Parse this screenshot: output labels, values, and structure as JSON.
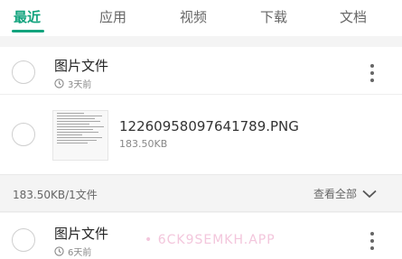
{
  "tabs": [
    {
      "label": "最近",
      "active": true
    },
    {
      "label": "应用",
      "active": false
    },
    {
      "label": "视频",
      "active": false
    },
    {
      "label": "下载",
      "active": false
    },
    {
      "label": "文档",
      "active": false
    }
  ],
  "groups": [
    {
      "title": "图片文件",
      "time": "3天前",
      "files": [
        {
          "name": "12260958097641789.PNG",
          "size": "183.50KB"
        }
      ],
      "summary": "183.50KB/1文件",
      "view_all": "查看全部"
    },
    {
      "title": "图片文件",
      "time": "6天前"
    }
  ],
  "watermark": "• 6CK9SEMKH.APP",
  "colors": {
    "accent": "#12a37d",
    "background": "#f4f4f4",
    "watermark": "#f3c6dc"
  },
  "icons": [
    "clock-icon",
    "more-vertical-icon",
    "chevron-down-icon",
    "radio-circle-icon"
  ]
}
